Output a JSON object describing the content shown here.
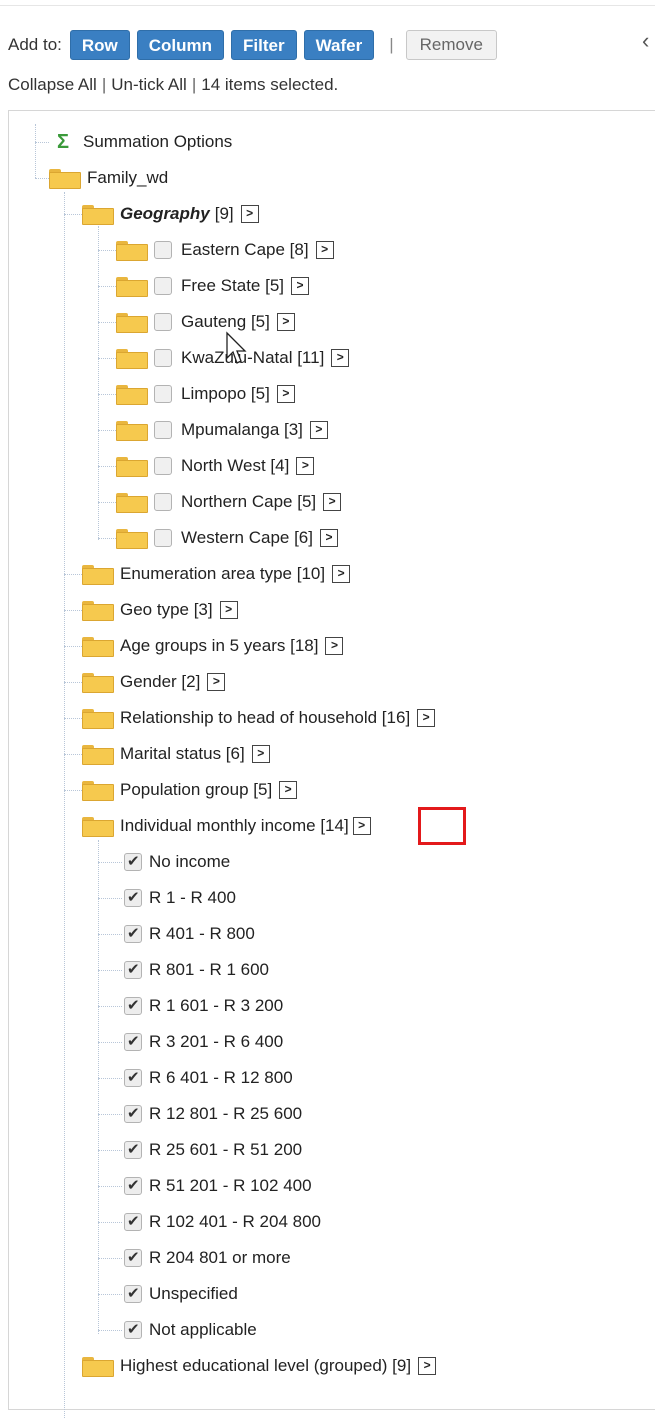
{
  "toolbar": {
    "label": "Add to:",
    "buttons": [
      "Row",
      "Column",
      "Filter",
      "Wafer"
    ],
    "separator": "|",
    "remove": "Remove"
  },
  "links": {
    "collapse_all": "Collapse All",
    "untick_all": "Un-tick All",
    "selected": "14 items selected."
  },
  "tree": {
    "summation": "Summation Options",
    "family": "Family_wd",
    "geography": {
      "name": "Geography",
      "count": "[9]",
      "items": [
        "Eastern Cape [8]",
        "Free State [5]",
        "Gauteng [5]",
        "KwaZulu-Natal [11]",
        "Limpopo [5]",
        "Mpumalanga [3]",
        "North West [4]",
        "Northern Cape [5]",
        "Western Cape [6]"
      ]
    },
    "folders_a": [
      "Enumeration area type [10]",
      "Geo type [3]",
      "Age groups in 5 years [18]",
      "Gender [2]",
      "Relationship to head of household [16]",
      "Marital status [6]",
      "Population group [5]"
    ],
    "income": {
      "name": "Individual monthly income [14]",
      "items": [
        "No income",
        "R 1 - R 400",
        "R 401 - R 800",
        "R 801 - R 1 600",
        "R 1 601 - R 3 200",
        "R 3 201 - R 6 400",
        "R 6 401 - R 12 800",
        "R 12 801 - R 25 600",
        "R 25 601 - R 51 200",
        "R 51 201 - R 102 400",
        "R 102 401 - R 204 800",
        "R 204 801 or more",
        "Unspecified",
        "Not applicable"
      ]
    },
    "last_folder": "Highest educational level (grouped) [9]"
  }
}
